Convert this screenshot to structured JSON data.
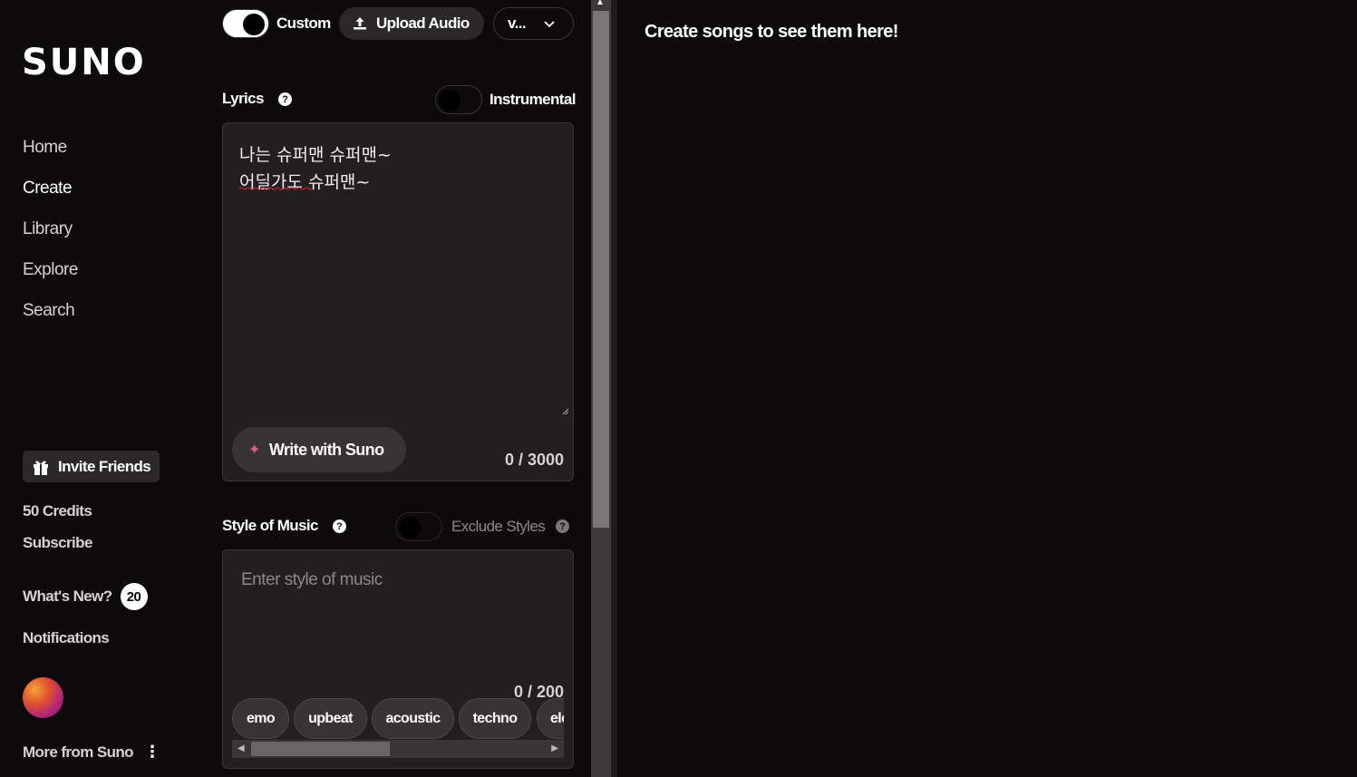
{
  "app": {
    "logo": "SUNO"
  },
  "sidebar": {
    "nav": [
      {
        "label": "Home"
      },
      {
        "label": "Create"
      },
      {
        "label": "Library"
      },
      {
        "label": "Explore"
      },
      {
        "label": "Search"
      }
    ],
    "invite_label": "Invite Friends",
    "credits": "50 Credits",
    "subscribe": "Subscribe",
    "whats_new": "What's New?",
    "whats_new_count": "20",
    "notifications": "Notifications",
    "more": "More from Suno"
  },
  "create": {
    "custom_label": "Custom",
    "custom_on": true,
    "upload_label": "Upload Audio",
    "version_label": "v...",
    "lyrics_label": "Lyrics",
    "instrumental_label": "Instrumental",
    "instrumental_on": false,
    "lyrics_value": "나는 슈퍼맨 슈퍼맨~\n어딜가도 슈퍼맨~",
    "write_label": "Write with Suno",
    "lyrics_counter": "0 / 3000",
    "style_label": "Style of Music",
    "exclude_label": "Exclude Styles",
    "exclude_on": false,
    "style_placeholder": "Enter style of music",
    "style_counter": "0 / 200",
    "tags": [
      "emo",
      "upbeat",
      "acoustic",
      "techno",
      "electronic"
    ]
  },
  "songs": {
    "empty_message": "Create songs to see them here!"
  },
  "colors": {
    "background": "#0d0a0b",
    "surface": "#231f20",
    "pill": "#2b2829",
    "accent_spark": "#e95b8a"
  }
}
